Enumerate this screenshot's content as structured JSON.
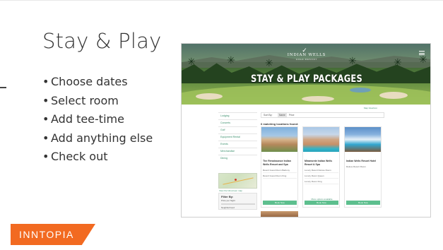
{
  "slide": {
    "title": "Stay & Play",
    "bullets": [
      "Choose dates",
      "Select room",
      "Add tee-time",
      "Add anything else",
      "Check out"
    ],
    "brand": "INNTOPIA",
    "brand_color": "#f26a21"
  },
  "website": {
    "logo_text": "INDIAN WELLS",
    "logo_sub": "GOLF RESORT",
    "hero_title": "STAY & PLAY PACKAGES",
    "nav_items": [
      "Lodging",
      "Concerts",
      "Golf",
      "Equipment Rental",
      "Events",
      "Merchandise",
      "Dining"
    ],
    "map_link": "View the full-screen map",
    "map_toggle": "Map View/List",
    "filter": {
      "title": "Filter By:",
      "price": "Price per Night",
      "neighborhood": "Neighborhood"
    },
    "sort": {
      "label": "Sort By:",
      "options": [
        "Name",
        "Price"
      ],
      "active": "Name"
    },
    "result_count": "6 matching locations found:",
    "accent_color": "#5dbf8e",
    "cards": [
      {
        "name": "The Renaissance Indian Wells Resort and Spa",
        "options": [
          "Resort Guest Room Balcony",
          "Resort Guest Room King"
        ],
        "book_label": "Book Now"
      },
      {
        "name": "Miramonte Indian Wells Resort & Spa",
        "options": [
          "Luxury Resort Deluxe Room",
          "Luxury Room Queen",
          "Luxury Room King"
        ],
        "more": "More options available",
        "book_label": "Book Now"
      },
      {
        "name": "Indian Wells Resort Hotel",
        "options": [
          "Deluxe Resort Room"
        ],
        "book_label": "Book Now"
      }
    ]
  }
}
